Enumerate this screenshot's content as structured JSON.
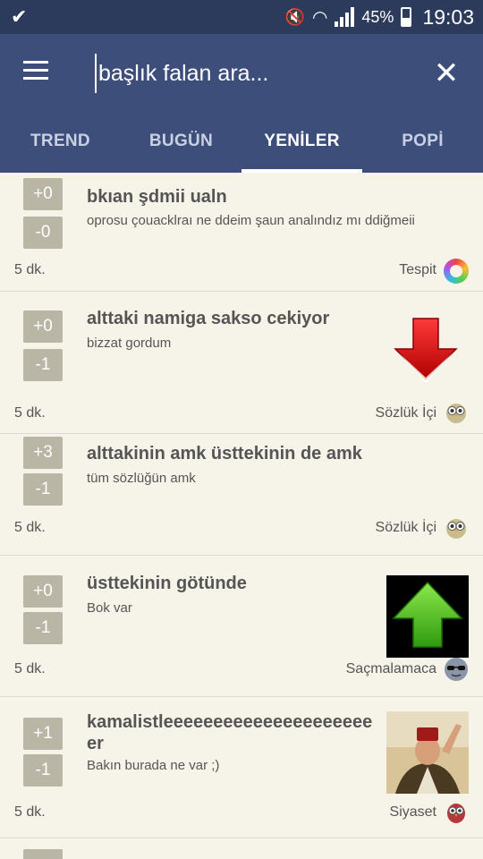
{
  "status_bar": {
    "battery": "45%",
    "time": "19:03"
  },
  "search": {
    "placeholder": "başlık falan ara..."
  },
  "tabs": [
    {
      "label": "TREND",
      "active": false
    },
    {
      "label": "BUGÜN",
      "active": false
    },
    {
      "label": "YENİLER",
      "active": true
    },
    {
      "label": "POPİ",
      "active": false
    }
  ],
  "entries": [
    {
      "up": "+0",
      "down": "-0",
      "title": "bkıan şdmii ualn",
      "body": "oprosu çouacklraı ne ddeim şaun analındız mı ddiğmeii",
      "time": "5 dk.",
      "category": "Tespit",
      "category_icon": "rainbow-circle-icon"
    },
    {
      "up": "+0",
      "down": "-1",
      "title": "alttaki namiga sakso cekiyor",
      "body": "bizzat gordum",
      "time": "5 dk.",
      "category": "Sözlük İçi",
      "category_icon": "owl-icon",
      "image": "red-down-arrow-image"
    },
    {
      "up": "+3",
      "down": "-1",
      "title": "alttakinin amk üsttekinin de amk",
      "body": "tüm sözlüğün amk",
      "time": "5 dk.",
      "category": "Sözlük İçi",
      "category_icon": "owl-icon"
    },
    {
      "up": "+0",
      "down": "-1",
      "title": "üsttekinin götünde",
      "body": "Bok var",
      "time": "5 dk.",
      "category": "Saçmalamaca",
      "category_icon": "sunglasses-face-icon",
      "image": "green-up-arrow-image"
    },
    {
      "up": "+1",
      "down": "-1",
      "title_line1": "kamalistleeeeeeeeeeeeeeeeeeeee",
      "title_line2": "er",
      "body": "Bakın burada ne var ;)",
      "time": "5 dk.",
      "category": "Siyaset",
      "category_icon": "red-owl-icon",
      "image": "man-with-fez-photo"
    }
  ],
  "colors": {
    "appbar": "#3d4e7a",
    "statusbar": "#2c3a5c",
    "background": "#f6f3e9",
    "vote_button": "#b9b6a5"
  }
}
